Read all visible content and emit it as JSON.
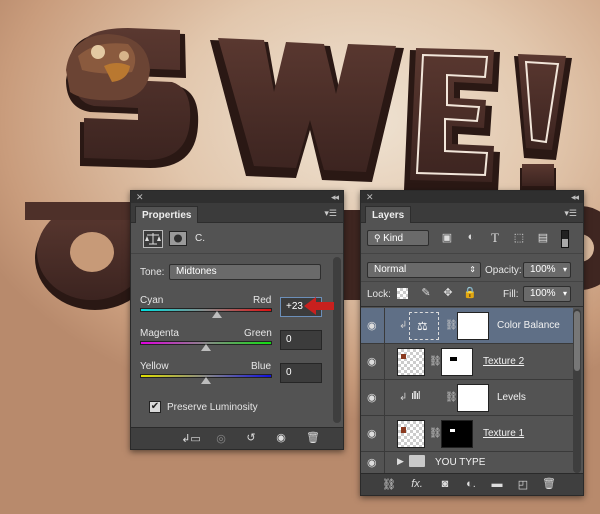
{
  "properties": {
    "tab_label": "Properties",
    "adjustment_short_name": "C.",
    "tone_label": "Tone:",
    "tone_value": "Midtones",
    "sliders": [
      {
        "left_label": "Cyan",
        "right_label": "Red",
        "value": "+23",
        "position": 0.6
      },
      {
        "left_label": "Magenta",
        "right_label": "Green",
        "value": "0",
        "position": 0.5
      },
      {
        "left_label": "Yellow",
        "right_label": "Blue",
        "value": "0",
        "position": 0.5
      }
    ],
    "preserve_luminosity_label": "Preserve Luminosity",
    "preserve_luminosity_checked": true
  },
  "layers": {
    "tab_label": "Layers",
    "filter_kind": "Kind",
    "blend_mode": "Normal",
    "opacity_label": "Opacity:",
    "opacity_value": "100%",
    "lock_label": "Lock:",
    "fill_label": "Fill:",
    "fill_value": "100%",
    "items": [
      {
        "name": "Color Balance",
        "underlined": false
      },
      {
        "name": "Texture 2",
        "underlined": true
      },
      {
        "name": "Levels",
        "underlined": false
      },
      {
        "name": "Texture 1",
        "underlined": true
      },
      {
        "name": "YOU TYPE",
        "underlined": false
      }
    ]
  },
  "colors": {
    "annotation_arrow": "#c8201e",
    "selected_row": "#5f6f86",
    "chocolate": "#4a2c25"
  }
}
